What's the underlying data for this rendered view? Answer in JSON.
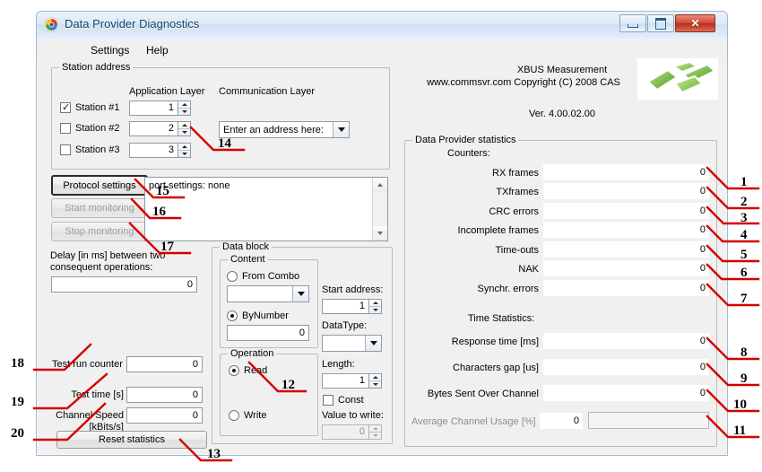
{
  "window": {
    "title": "Data Provider Diagnostics",
    "icon": "app-swirl-icon",
    "buttons": {
      "minimize": "minimize-icon",
      "maximize": "maximize-icon",
      "close": "✕"
    }
  },
  "menu": {
    "settings": "Settings",
    "help": "Help"
  },
  "station_address": {
    "title": "Station address",
    "col_app": "Application Layer",
    "col_comm": "Communication Layer",
    "rows": [
      {
        "label": "Station #1",
        "checked": true,
        "value": "1"
      },
      {
        "label": "Station #2",
        "checked": false,
        "value": "2"
      },
      {
        "label": "Station #3",
        "checked": false,
        "value": "3"
      }
    ],
    "comm_combo_value": "Enter an address here:"
  },
  "branding": {
    "line1": "XBUS Measurement",
    "line2": "www.commsvr.com  Copyright (C) 2008 CAS",
    "version": "Ver. 4.00.02.00",
    "logo": "cas-green-blocks-logo"
  },
  "controls": {
    "protocol_settings": "Protocol settings",
    "start_monitoring": "Start monitoring",
    "stop_monitoring": "Stop monitoring",
    "log_text": "port settings: none",
    "delay_label_l1": "Delay [in ms] between two",
    "delay_label_l2": "consequent operations:",
    "delay_value": "0"
  },
  "data_block": {
    "title": "Data block",
    "content": {
      "title": "Content",
      "from_combo_label": "From Combo",
      "from_combo_selected": false,
      "combo_value": "",
      "by_number_label": "ByNumber",
      "by_number_selected": true,
      "by_number_value": "0"
    },
    "operation": {
      "title": "Operation",
      "read_label": "Read",
      "read_selected": true,
      "write_label": "Write",
      "write_selected": false
    },
    "start_address_label": "Start address:",
    "start_address_value": "1",
    "datatype_label": "DataType:",
    "datatype_value": "",
    "length_label": "Length:",
    "length_value": "1",
    "const_label": "Const",
    "const_checked": false,
    "value_to_write_label": "Value to write:",
    "value_to_write_value": "0"
  },
  "test": {
    "run_counter_label": "Test run counter",
    "run_counter_value": "0",
    "test_time_label": "Test time [s]",
    "test_time_value": "0",
    "channel_speed_l1": "Channel Speed",
    "channel_speed_l2": "[kBits/s]",
    "channel_speed_value": "0",
    "reset_button": "Reset statistics"
  },
  "statistics": {
    "title": "Data Provider statistics",
    "counters_header": "Counters:",
    "counters": [
      {
        "label": "RX frames",
        "value": "0"
      },
      {
        "label": "TXframes",
        "value": "0"
      },
      {
        "label": "CRC errors",
        "value": "0"
      },
      {
        "label": "Incomplete frames",
        "value": "0"
      },
      {
        "label": "Time-outs",
        "value": "0"
      },
      {
        "label": "NAK",
        "value": "0"
      },
      {
        "label": "Synchr. errors",
        "value": "0"
      }
    ],
    "time_header": "Time Statistics:",
    "time_stats": [
      {
        "label": "Response time [ms]",
        "value": "0"
      },
      {
        "label": "Characters gap  [us]",
        "value": "0"
      },
      {
        "label": "Bytes Sent Over Channel",
        "value": "0"
      }
    ],
    "avg_usage_label": "Average Channel Usage [%]",
    "avg_usage_value": "0",
    "avg_usage_percent": 0
  },
  "annotations": {
    "color": "#d40000",
    "numbers": [
      "1",
      "2",
      "3",
      "4",
      "5",
      "6",
      "7",
      "8",
      "9",
      "10",
      "11",
      "12",
      "13",
      "14",
      "15",
      "16",
      "17",
      "18",
      "19",
      "20"
    ]
  }
}
